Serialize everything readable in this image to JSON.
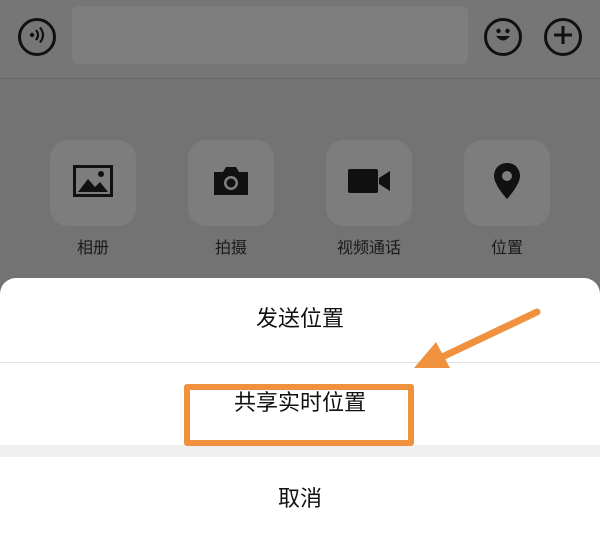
{
  "colors": {
    "accent": "#f0913d",
    "overlay": "#737373",
    "sheet": "#ffffff"
  },
  "input_bar": {
    "voice_icon": "voice-icon",
    "emoji_icon": "emoji-icon",
    "plus_icon": "plus-icon"
  },
  "tools": [
    {
      "label": "相册",
      "icon": "photo-icon"
    },
    {
      "label": "拍摄",
      "icon": "camera-icon"
    },
    {
      "label": "视频通话",
      "icon": "video-call-icon"
    },
    {
      "label": "位置",
      "icon": "location-icon"
    }
  ],
  "sheet": {
    "send_location": "发送位置",
    "share_live_location": "共享实时位置",
    "cancel": "取消"
  }
}
